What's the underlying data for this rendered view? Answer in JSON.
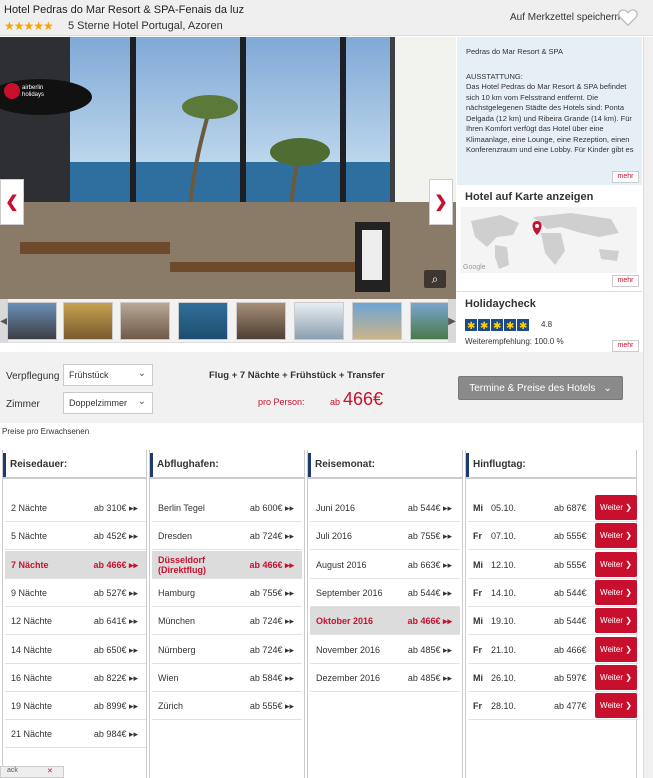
{
  "header": {
    "title": "Hotel Pedras do Mar Resort & SPA-Fenais da luz",
    "stars": "★★★★★",
    "subtitle": "5 Sterne Hotel Portugal, Azoren",
    "wishlist_label": "Auf Merkzettel speichern"
  },
  "gallery": {
    "logo_text": "airberlin holidays",
    "prev": "❮",
    "next": "❯",
    "zoom": "⌕",
    "thumb_count": 8
  },
  "description": {
    "title": "Pedras do Mar Resort & SPA",
    "heading": "AUSSTATTUNG:",
    "text": "Das Hotel Pedras do Mar Resort & SPA befindet sich 10 km vom Felsstrand entfernt. Die nächstgelegenen Städte des Hotels sind: Ponta Delgada (12 km) und Ribeira Grande (14 km). Für Ihren Komfort verfügt das Hotel über eine Klimaanlage, eine Lounge, eine Rezeption, einen Konferenzraum und eine Lobby. Für Kinder gibt es",
    "more": "mehr"
  },
  "map": {
    "title": "Hotel auf Karte anzeigen",
    "watermark": "Google",
    "more": "mehr"
  },
  "holidaycheck": {
    "title": "Holidaycheck",
    "score": "4.8",
    "recommendation": "Weiterempfehlung: 100.0 %",
    "more": "mehr"
  },
  "filters": {
    "verpflegung_label": "Verpflegung",
    "verpflegung_value": "Frühstück",
    "zimmer_label": "Zimmer",
    "zimmer_value": "Doppelzimmer",
    "package": "Flug + 7 Nächte + Frühstück + Transfer",
    "per_person_label": "pro Person:",
    "price_prefix": "ab",
    "price": "466€",
    "termine_button": "Termine & Preise des Hotels",
    "note": "Preise pro Erwachsenen"
  },
  "columns": {
    "reisedauer": {
      "header": "Reisedauer:",
      "rows": [
        {
          "label": "2 Nächte",
          "price": "ab 310€ ▸▸",
          "selected": false
        },
        {
          "label": "5 Nächte",
          "price": "ab 452€ ▸▸",
          "selected": false
        },
        {
          "label": "7 Nächte",
          "price": "ab 466€ ▸▸",
          "selected": true
        },
        {
          "label": "9 Nächte",
          "price": "ab 527€ ▸▸",
          "selected": false
        },
        {
          "label": "12 Nächte",
          "price": "ab 641€ ▸▸",
          "selected": false
        },
        {
          "label": "14 Nächte",
          "price": "ab 650€ ▸▸",
          "selected": false
        },
        {
          "label": "16 Nächte",
          "price": "ab 822€ ▸▸",
          "selected": false
        },
        {
          "label": "19 Nächte",
          "price": "ab 899€ ▸▸",
          "selected": false
        },
        {
          "label": "21 Nächte",
          "price": "ab 984€ ▸▸",
          "selected": false
        }
      ]
    },
    "abflughafen": {
      "header": "Abflughafen:",
      "rows": [
        {
          "label": "Berlin Tegel",
          "price": "ab 600€ ▸▸",
          "selected": false
        },
        {
          "label": "Dresden",
          "price": "ab 724€ ▸▸",
          "selected": false
        },
        {
          "label": "Düsseldorf (Direktflug)",
          "price": "ab 466€ ▸▸",
          "selected": true
        },
        {
          "label": "Hamburg",
          "price": "ab 755€ ▸▸",
          "selected": false
        },
        {
          "label": "München",
          "price": "ab 724€ ▸▸",
          "selected": false
        },
        {
          "label": "Nürnberg",
          "price": "ab 724€ ▸▸",
          "selected": false
        },
        {
          "label": "Wien",
          "price": "ab 584€ ▸▸",
          "selected": false
        },
        {
          "label": "Zürich",
          "price": "ab 555€ ▸▸",
          "selected": false
        }
      ]
    },
    "reisemonat": {
      "header": "Reisemonat:",
      "rows": [
        {
          "label": "Juni 2016",
          "price": "ab 544€ ▸▸",
          "selected": false
        },
        {
          "label": "Juli 2016",
          "price": "ab 755€ ▸▸",
          "selected": false
        },
        {
          "label": "August 2016",
          "price": "ab 663€ ▸▸",
          "selected": false
        },
        {
          "label": "September 2016",
          "price": "ab 544€ ▸▸",
          "selected": false
        },
        {
          "label": "Oktober 2016",
          "price": "ab 466€ ▸▸",
          "selected": true
        },
        {
          "label": "November 2016",
          "price": "ab 485€ ▸▸",
          "selected": false
        },
        {
          "label": "Dezember 2016",
          "price": "ab 485€ ▸▸",
          "selected": false
        }
      ]
    },
    "hinflugtag": {
      "header": "Hinflugtag:",
      "button_label": "Weiter ❯",
      "rows": [
        {
          "day": "Mi",
          "date": "05.10.",
          "price": "ab 687€"
        },
        {
          "day": "Fr",
          "date": "07.10.",
          "price": "ab 555€"
        },
        {
          "day": "Mi",
          "date": "12.10.",
          "price": "ab 555€"
        },
        {
          "day": "Fr",
          "date": "14.10.",
          "price": "ab 544€"
        },
        {
          "day": "Mi",
          "date": "19.10.",
          "price": "ab 544€"
        },
        {
          "day": "Fr",
          "date": "21.10.",
          "price": "ab 466€"
        },
        {
          "day": "Mi",
          "date": "26.10.",
          "price": "ab 597€"
        },
        {
          "day": "Fr",
          "date": "28.10.",
          "price": "ab 477€"
        }
      ]
    }
  },
  "bottom_tag": {
    "text": "ack",
    "close": "✕"
  },
  "colors": {
    "accent": "#c8102e",
    "navy": "#1e3a6e",
    "star": "#f5a400"
  }
}
